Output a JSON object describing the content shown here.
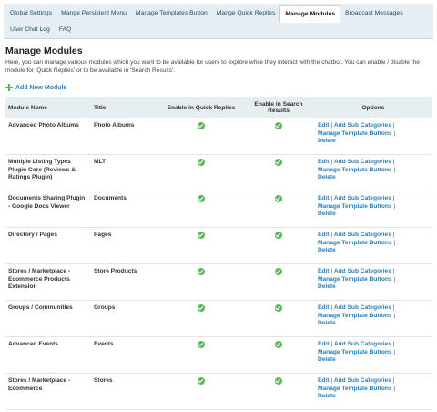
{
  "tabs": [
    "Global Settings",
    "Mange Persistent Menu",
    "Manage Templates Button",
    "Mange Quick Replies",
    "Manage Modules",
    "Broadcast Messages",
    "User Chat Log",
    "FAQ"
  ],
  "active_tab": "Manage Modules",
  "page": {
    "title": "Manage Modules",
    "description": "Here, you can manage various modules which you want to be available for users to explore while they interact with the chatbot. You can enable / disable the module for 'Quick Replies' or to be available in 'Search Results'.",
    "add_label": "Add New Module"
  },
  "table": {
    "headers": [
      "Module Name",
      "Title",
      "Enable in Quick Replies",
      "Enable in Search Results",
      "Options"
    ],
    "option_links": [
      "Edit",
      "Add Sub Categories",
      "Manage Template Buttons",
      "Delete"
    ],
    "option_separator": "|",
    "rows": [
      {
        "name": "Advanced Photo Albums",
        "title": "Photo Albums",
        "quick": true,
        "search": true
      },
      {
        "name": "Multiple Listing Types Plugin Core (Reviews & Ratings Plugin)",
        "title": "MLT",
        "quick": true,
        "search": true
      },
      {
        "name": "Documents Sharing Plugin - Google Docs Viewer",
        "title": "Documents",
        "quick": true,
        "search": true
      },
      {
        "name": "Directory / Pages",
        "title": "Pages",
        "quick": true,
        "search": true
      },
      {
        "name": "Stores / Marketplace - Ecommerce Products Extension",
        "title": "Store Products",
        "quick": true,
        "search": true
      },
      {
        "name": "Groups / Communities",
        "title": "Groups",
        "quick": true,
        "search": true
      },
      {
        "name": "Advanced Events",
        "title": "Events",
        "quick": true,
        "search": true
      },
      {
        "name": "Stores / Marketplace - Ecommerce",
        "title": "Stores",
        "quick": true,
        "search": true
      }
    ]
  },
  "icons": {
    "enabled": "check-circle-icon",
    "add": "plus-icon"
  },
  "colors": {
    "link": "#2a7fb8",
    "check": "#5cb85c",
    "tabbar": "#e4eef3",
    "header_row": "#e6eef2"
  }
}
